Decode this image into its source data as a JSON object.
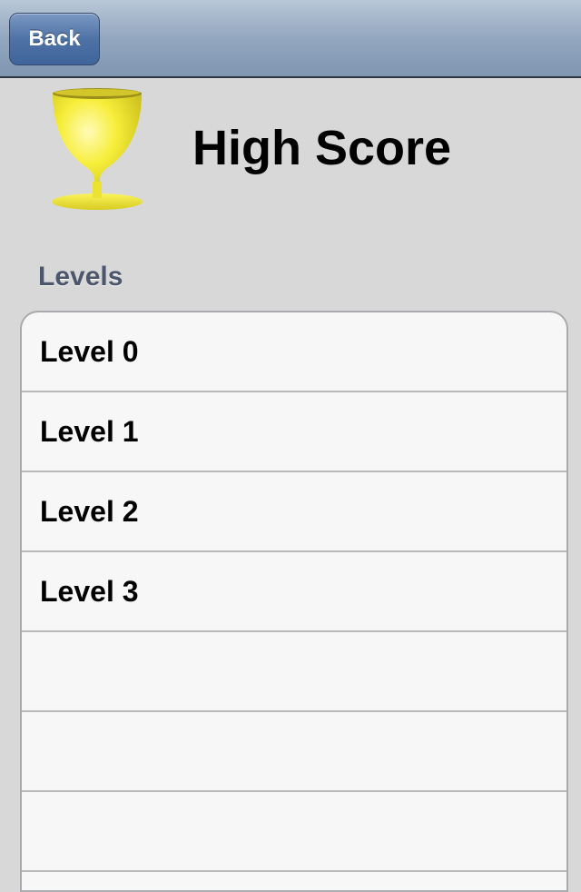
{
  "navbar": {
    "back_label": "Back"
  },
  "header": {
    "title": "High Score",
    "icon": "trophy-icon"
  },
  "levels": {
    "section_label": "Levels",
    "rows": [
      "Level 0",
      "Level 1",
      "Level 2",
      "Level 3",
      "",
      "",
      ""
    ]
  },
  "colors": {
    "navbar": "#93a7bf",
    "back_button": "#4f72a5",
    "background": "#d8d8d8",
    "section_label": "#4c566c",
    "trophy": "#f5ea2a"
  }
}
